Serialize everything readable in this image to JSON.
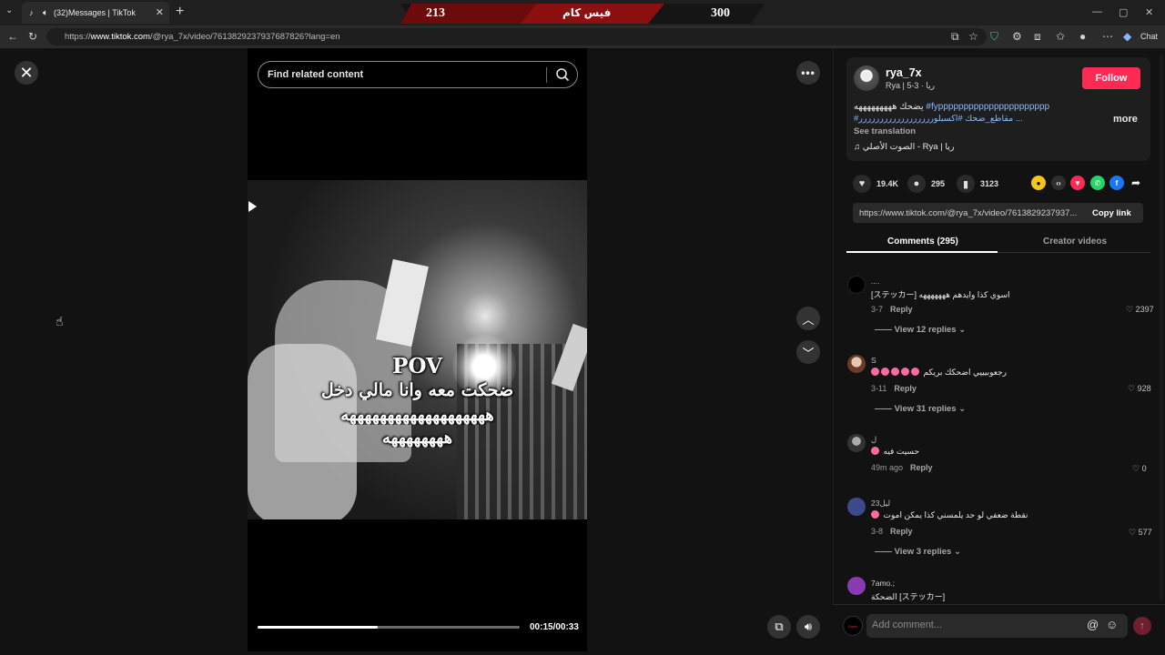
{
  "browser": {
    "tab_title": "(32)Messages | TikTok",
    "url_prefix": "https://",
    "url_domain": "www.tiktok.com",
    "url_path": "/@rya_7x/video/7613829237937687826?lang=en",
    "chat_label": "Chat",
    "overlay_score_left": "213",
    "overlay_center_text": "فيس كام",
    "overlay_score_right": "300"
  },
  "video": {
    "search_placeholder": "Find related content",
    "caption_line1": "POV",
    "caption_line2": "ضحكت معه وانا مالي دخل",
    "caption_line3": "هههههههههههههههههههه",
    "caption_line4": "ههههههههه",
    "time": "00:15/00:33",
    "progress": 0.46
  },
  "post": {
    "username": "rya_7x",
    "subline": "Rya | ريا · 3-5",
    "follow_label": "Follow",
    "desc_line1_text": "يضحك هههههههههه ",
    "desc_line1_tag": "#fypppppppppppppppppppppp",
    "desc_line2_tag": "#مقاطع_ضحك #اكسبلورررررررررررررررررر ...",
    "more_label": "more",
    "see_translation": "See translation",
    "music": "♫  الصوت الأصلي - Rya | ريا",
    "likes": "19.4K",
    "comments": "295",
    "saves": "3123",
    "link": "https://www.tiktok.com/@rya_7x/video/7613829237937...",
    "copy_link": "Copy link"
  },
  "tabs": {
    "comments": "Comments (295)",
    "creator": "Creator videos"
  },
  "comments": [
    {
      "name": "....",
      "text": "[ステッカー] اسوي كذا وايدهم هههههههه",
      "date": "3-7",
      "reply": "Reply",
      "likes": "2397",
      "replies": "View 12 replies"
    },
    {
      "name": "S",
      "text": "رجعوبيييي اضحكك بريكم",
      "date": "3-11",
      "reply": "Reply",
      "likes": "928",
      "replies": "View 31 replies"
    },
    {
      "name": "ل",
      "text": "حسيت فيه",
      "date": "49m ago",
      "reply": "Reply",
      "likes": "0",
      "replies": ""
    },
    {
      "name": "ليل23",
      "text": "نقطة ضعفي لو حد يلمسني كذا يمكن اموت",
      "date": "3-8",
      "reply": "Reply",
      "likes": "577",
      "replies": "View 3 replies"
    },
    {
      "name": "7amo.;",
      "text": "الضحكة [ステッカー]",
      "date": "",
      "reply": "",
      "likes": "",
      "replies": ""
    }
  ],
  "composer": {
    "placeholder": "Add comment...",
    "avatar_text": "Gavin"
  },
  "icons": {
    "close": "close-icon",
    "search": "search-icon",
    "more": "more-icon",
    "up": "chevron-up-icon",
    "down": "chevron-down-icon",
    "volume": "volume-icon",
    "pip": "pip-icon"
  }
}
